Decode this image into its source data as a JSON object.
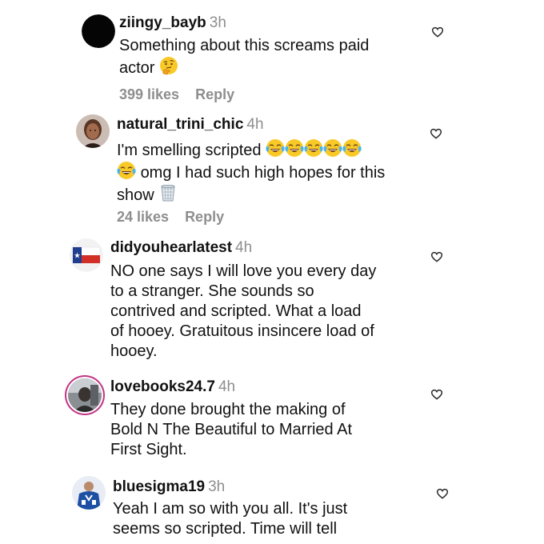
{
  "comments": [
    {
      "username": "ziingy_bayb",
      "time": "3h",
      "lines": [
        "Something about this screams paid",
        "actor"
      ],
      "likes": "399 likes",
      "reply": "Reply"
    },
    {
      "username": "natural_trini_chic",
      "time": "4h",
      "lines": [
        "I'm smelling scripted",
        "omg I had such high hopes for this",
        "show"
      ],
      "likes": "24 likes",
      "reply": "Reply"
    },
    {
      "username": "didyouhearlatest",
      "time": "4h",
      "lines": [
        "NO one says I will love you every day",
        "to a stranger.  She sounds so",
        "contrived and scripted. What a load",
        "of hooey. Gratuitous insincere load of",
        "hooey."
      ]
    },
    {
      "username": "lovebooks24.7",
      "time": "4h",
      "lines": [
        "They done brought the making of",
        "Bold N The Beautiful to Married At",
        "First Sight."
      ]
    },
    {
      "username": "bluesigma19",
      "time": "3h",
      "lines": [
        "Yeah I am so with you all. It's just",
        "seems so scripted. Time will tell"
      ]
    }
  ],
  "icons": {
    "like": "heart-outline-icon",
    "thinking": "thinking-face-emoji",
    "laughing": "face-with-tears-of-joy-emoji",
    "trash": "wastebasket-emoji"
  },
  "colors": {
    "username": "#111111",
    "meta": "#8e8e8e",
    "emoji_yellow": "#f9c928",
    "flag_blue": "#1f3e8f",
    "flag_red": "#d22f27"
  }
}
